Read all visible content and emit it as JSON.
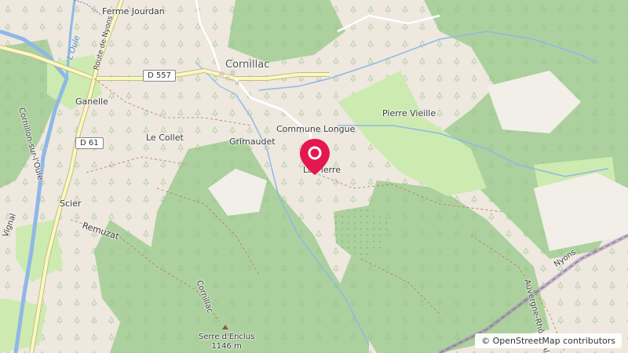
{
  "map": {
    "labels": {
      "ferme_jourdan": "Ferme Jourdan",
      "cornillac": "Cornillac",
      "ganelle": "Ganelle",
      "le_collet": "Le Collet",
      "grimaudet": "Grimaudet",
      "commune_longue": "Commune Longue",
      "pierre_vieille": "Pierre Vieille",
      "la_pierre": "La Pierre",
      "scier": "Scier",
      "remuzat": "Remuzat",
      "cornillac_side": "Cornillac",
      "serre_name": "Serre d'Enclus",
      "serre_elev": "1146 m",
      "nyons": "Nyons",
      "region": "Auvergne-Rhône-Alpes",
      "cornillon": "Cornillon-sur-l'Oule",
      "vignal": "Vignal",
      "oule_river": "L'Oule",
      "route_nyons": "Route de Nyons"
    },
    "road_shields": {
      "d557": "D 557",
      "d61": "D 61"
    },
    "attribution": "© OpenStreetMap contributors",
    "colors": {
      "forest": "#add19e",
      "meadow": "#cdebb0",
      "land": "#eee8df",
      "water": "#8fb8e6",
      "road_major": "#f7fabf",
      "marker": "#e4174f"
    }
  }
}
